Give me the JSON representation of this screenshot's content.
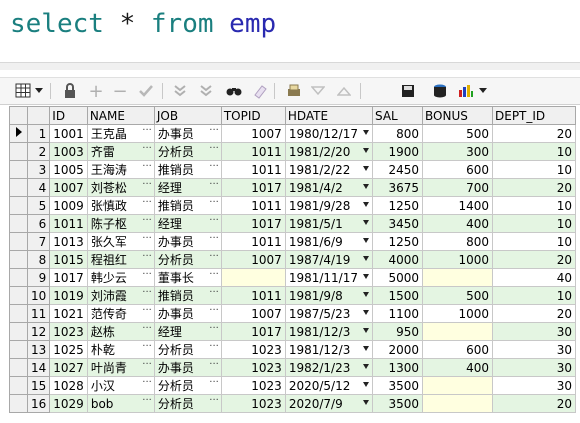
{
  "sql": {
    "kw1": "select",
    "star": "*",
    "kw2": "from",
    "table": "emp"
  },
  "toolbar": {
    "icons": [
      "grid-icon",
      "lock-icon",
      "add-icon",
      "remove-icon",
      "check-icon",
      "filter-down-icon",
      "filter-up-icon",
      "binoculars-icon",
      "eraser-icon",
      "print-icon",
      "triangle-down-icon",
      "triangle-up-icon",
      "save-icon",
      "database-icon",
      "chart-icon"
    ]
  },
  "grid": {
    "headers": [
      "ID",
      "NAME",
      "JOB",
      "TOPID",
      "HDATE",
      "SAL",
      "BONUS",
      "DEPT_ID"
    ],
    "rows": [
      {
        "n": "1",
        "id": "1001",
        "name": "王克晶",
        "job": "办事员",
        "topid": "1007",
        "hdate": "1980/12/17",
        "sal": "800",
        "bonus": "500",
        "dept": "20"
      },
      {
        "n": "2",
        "id": "1003",
        "name": "齐雷",
        "job": "分析员",
        "topid": "1011",
        "hdate": "1981/2/20",
        "sal": "1900",
        "bonus": "300",
        "dept": "10"
      },
      {
        "n": "3",
        "id": "1005",
        "name": "王海涛",
        "job": "推销员",
        "topid": "1011",
        "hdate": "1981/2/22",
        "sal": "2450",
        "bonus": "600",
        "dept": "10"
      },
      {
        "n": "4",
        "id": "1007",
        "name": "刘苍松",
        "job": "经理",
        "topid": "1017",
        "hdate": "1981/4/2",
        "sal": "3675",
        "bonus": "700",
        "dept": "20"
      },
      {
        "n": "5",
        "id": "1009",
        "name": "张慎政",
        "job": "推销员",
        "topid": "1011",
        "hdate": "1981/9/28",
        "sal": "1250",
        "bonus": "1400",
        "dept": "10"
      },
      {
        "n": "6",
        "id": "1011",
        "name": "陈子枢",
        "job": "经理",
        "topid": "1017",
        "hdate": "1981/5/1",
        "sal": "3450",
        "bonus": "400",
        "dept": "10"
      },
      {
        "n": "7",
        "id": "1013",
        "name": "张久军",
        "job": "办事员",
        "topid": "1011",
        "hdate": "1981/6/9",
        "sal": "1250",
        "bonus": "800",
        "dept": "10"
      },
      {
        "n": "8",
        "id": "1015",
        "name": "程祖红",
        "job": "分析员",
        "topid": "1007",
        "hdate": "1987/4/19",
        "sal": "4000",
        "bonus": "1000",
        "dept": "20"
      },
      {
        "n": "9",
        "id": "1017",
        "name": "韩少云",
        "job": "董事长",
        "topid": "",
        "hdate": "1981/11/17",
        "sal": "5000",
        "bonus": "",
        "dept": "40"
      },
      {
        "n": "10",
        "id": "1019",
        "name": "刘沛霞",
        "job": "推销员",
        "topid": "1011",
        "hdate": "1981/9/8",
        "sal": "1500",
        "bonus": "500",
        "dept": "10"
      },
      {
        "n": "11",
        "id": "1021",
        "name": "范传奇",
        "job": "办事员",
        "topid": "1007",
        "hdate": "1987/5/23",
        "sal": "1100",
        "bonus": "1000",
        "dept": "20"
      },
      {
        "n": "12",
        "id": "1023",
        "name": "赵栋",
        "job": "经理",
        "topid": "1017",
        "hdate": "1981/12/3",
        "sal": "950",
        "bonus": "",
        "dept": "30"
      },
      {
        "n": "13",
        "id": "1025",
        "name": "朴乾",
        "job": "分析员",
        "topid": "1023",
        "hdate": "1981/12/3",
        "sal": "2000",
        "bonus": "600",
        "dept": "30"
      },
      {
        "n": "14",
        "id": "1027",
        "name": "叶尚青",
        "job": "办事员",
        "topid": "1023",
        "hdate": "1982/1/23",
        "sal": "1300",
        "bonus": "400",
        "dept": "30"
      },
      {
        "n": "15",
        "id": "1028",
        "name": "小汉",
        "job": "分析员",
        "topid": "1023",
        "hdate": "2020/5/12",
        "sal": "3500",
        "bonus": "",
        "dept": "30"
      },
      {
        "n": "16",
        "id": "1029",
        "name": "bob",
        "job": "分析员",
        "topid": "1023",
        "hdate": "2020/7/9",
        "sal": "3500",
        "bonus": "",
        "dept": "20"
      }
    ]
  }
}
